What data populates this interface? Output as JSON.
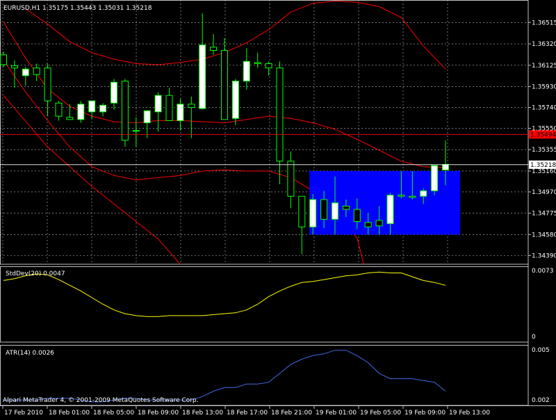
{
  "header": {
    "symbol_text": "EURUSD,H1  1.35175 1.35443 1.35031 1.35218"
  },
  "chart_data": [
    {
      "type": "candlestick",
      "symbol": "EURUSD",
      "timeframe": "H1",
      "ohlc_header": {
        "open": 1.35175,
        "high": 1.35443,
        "low": 1.35031,
        "close": 1.35218
      },
      "y_ticks": [
        1.36515,
        1.3632,
        1.36125,
        1.3593,
        1.3574,
        1.3555,
        1.35355,
        1.3516,
        1.3497,
        1.34775,
        1.3458,
        1.3439
      ],
      "ylim": [
        1.3431,
        1.3672
      ],
      "price_markers": [
        {
          "value": "1.35494",
          "color": "#ff0000",
          "text_color": "#000000"
        },
        {
          "value": "1.35218",
          "color": "#ffffff",
          "text_color": "#000000"
        }
      ],
      "x_tick_labels": [
        "17 Feb 2010",
        "18 Feb 01:00",
        "18 Feb 05:00",
        "18 Feb 09:00",
        "18 Feb 13:00",
        "18 Feb 17:00",
        "18 Feb 21:00",
        "19 Feb 01:00",
        "19 Feb 05:00",
        "19 Feb 09:00",
        "19 Feb 13:00"
      ],
      "candles": [
        {
          "o": 1.3622,
          "h": 1.3625,
          "l": 1.3611,
          "c": 1.3613
        },
        {
          "o": 1.3612,
          "h": 1.3617,
          "l": 1.3592,
          "c": 1.361
        },
        {
          "o": 1.3603,
          "h": 1.3611,
          "l": 1.3594,
          "c": 1.3609
        },
        {
          "o": 1.361,
          "h": 1.3614,
          "l": 1.3598,
          "c": 1.3604
        },
        {
          "o": 1.361,
          "h": 1.3614,
          "l": 1.3566,
          "c": 1.358
        },
        {
          "o": 1.3578,
          "h": 1.358,
          "l": 1.3562,
          "c": 1.3566
        },
        {
          "o": 1.3565,
          "h": 1.3577,
          "l": 1.3563,
          "c": 1.3563
        },
        {
          "o": 1.3563,
          "h": 1.358,
          "l": 1.356,
          "c": 1.3577
        },
        {
          "o": 1.357,
          "h": 1.358,
          "l": 1.3564,
          "c": 1.358
        },
        {
          "o": 1.357,
          "h": 1.3578,
          "l": 1.3566,
          "c": 1.3576
        },
        {
          "o": 1.3578,
          "h": 1.36,
          "l": 1.3572,
          "c": 1.3597
        },
        {
          "o": 1.3598,
          "h": 1.36,
          "l": 1.3538,
          "c": 1.3544
        },
        {
          "o": 1.3553,
          "h": 1.3565,
          "l": 1.3538,
          "c": 1.3553
        },
        {
          "o": 1.356,
          "h": 1.357,
          "l": 1.3546,
          "c": 1.3571
        },
        {
          "o": 1.357,
          "h": 1.3588,
          "l": 1.3552,
          "c": 1.3585
        },
        {
          "o": 1.3585,
          "h": 1.3592,
          "l": 1.3562,
          "c": 1.3562
        },
        {
          "o": 1.3562,
          "h": 1.3582,
          "l": 1.3553,
          "c": 1.3577
        },
        {
          "o": 1.3577,
          "h": 1.3584,
          "l": 1.3546,
          "c": 1.3574
        },
        {
          "o": 1.3573,
          "h": 1.366,
          "l": 1.3572,
          "c": 1.3631
        },
        {
          "o": 1.3629,
          "h": 1.3641,
          "l": 1.3622,
          "c": 1.3626
        },
        {
          "o": 1.3626,
          "h": 1.3637,
          "l": 1.3563,
          "c": 1.3563
        },
        {
          "o": 1.3564,
          "h": 1.36,
          "l": 1.3558,
          "c": 1.3598
        },
        {
          "o": 1.3598,
          "h": 1.3628,
          "l": 1.359,
          "c": 1.3616
        },
        {
          "o": 1.3615,
          "h": 1.3624,
          "l": 1.361,
          "c": 1.3614
        },
        {
          "o": 1.3614,
          "h": 1.3616,
          "l": 1.3603,
          "c": 1.361
        },
        {
          "o": 1.361,
          "h": 1.3616,
          "l": 1.3504,
          "c": 1.3525
        },
        {
          "o": 1.3525,
          "h": 1.3534,
          "l": 1.3482,
          "c": 1.3493
        },
        {
          "o": 1.3493,
          "h": 1.3493,
          "l": 1.344,
          "c": 1.3465
        },
        {
          "o": 1.3465,
          "h": 1.3495,
          "l": 1.3458,
          "c": 1.349
        },
        {
          "o": 1.349,
          "h": 1.3498,
          "l": 1.3464,
          "c": 1.3472
        },
        {
          "o": 1.3472,
          "h": 1.3511,
          "l": 1.3458,
          "c": 1.3487
        },
        {
          "o": 1.3484,
          "h": 1.349,
          "l": 1.3474,
          "c": 1.3481
        },
        {
          "o": 1.3481,
          "h": 1.3491,
          "l": 1.3463,
          "c": 1.347
        },
        {
          "o": 1.3469,
          "h": 1.3478,
          "l": 1.3458,
          "c": 1.3465
        },
        {
          "o": 1.3471,
          "h": 1.3484,
          "l": 1.3458,
          "c": 1.3466
        },
        {
          "o": 1.3468,
          "h": 1.3496,
          "l": 1.3458,
          "c": 1.3494
        },
        {
          "o": 1.3494,
          "h": 1.3516,
          "l": 1.3491,
          "c": 1.3493
        },
        {
          "o": 1.3493,
          "h": 1.3516,
          "l": 1.349,
          "c": 1.3492
        },
        {
          "o": 1.3493,
          "h": 1.35,
          "l": 1.3486,
          "c": 1.3498
        },
        {
          "o": 1.3498,
          "h": 1.3517,
          "l": 1.3494,
          "c": 1.3521
        },
        {
          "o": 1.3517,
          "h": 1.3544,
          "l": 1.3503,
          "c": 1.3522
        }
      ],
      "band_lines": [
        {
          "color": "#ff0000",
          "points": [
            [
              0,
              1.3652
            ],
            [
              2,
              1.3619
            ],
            [
              4,
              1.3591
            ],
            [
              6,
              1.3575
            ],
            [
              8,
              1.3566
            ],
            [
              10,
              1.3561
            ],
            [
              12,
              1.356
            ],
            [
              14,
              1.3562
            ],
            [
              16,
              1.3562
            ],
            [
              18,
              1.3561
            ],
            [
              20,
              1.356
            ],
            [
              22,
              1.3563
            ],
            [
              24,
              1.3566
            ],
            [
              26,
              1.3564
            ],
            [
              27,
              1.3562
            ],
            [
              28,
              1.356
            ],
            [
              30,
              1.3554
            ],
            [
              32,
              1.3545
            ],
            [
              34,
              1.3535
            ],
            [
              36,
              1.3525
            ],
            [
              38,
              1.352
            ],
            [
              40,
              1.3519
            ]
          ]
        },
        {
          "color": "#ff0000",
          "points": [
            [
              2,
              1.3664
            ],
            [
              4,
              1.365
            ],
            [
              6,
              1.3634
            ],
            [
              8,
              1.3624
            ],
            [
              10,
              1.3618
            ],
            [
              12,
              1.3614
            ],
            [
              14,
              1.3613
            ],
            [
              16,
              1.3615
            ],
            [
              18,
              1.3618
            ],
            [
              20,
              1.3624
            ],
            [
              22,
              1.3633
            ],
            [
              24,
              1.3645
            ],
            [
              26,
              1.3661
            ],
            [
              28,
              1.3669
            ],
            [
              30,
              1.3671
            ],
            [
              32,
              1.367
            ],
            [
              34,
              1.3666
            ],
            [
              36,
              1.3656
            ],
            [
              38,
              1.363
            ],
            [
              40,
              1.3609
            ]
          ]
        },
        {
          "color": "#ff0000",
          "points": [
            [
              0,
              1.3617
            ],
            [
              2,
              1.3588
            ],
            [
              4,
              1.3562
            ],
            [
              6,
              1.3538
            ],
            [
              8,
              1.352
            ],
            [
              10,
              1.3512
            ],
            [
              12,
              1.3508
            ],
            [
              14,
              1.351
            ],
            [
              16,
              1.3512
            ],
            [
              18,
              1.3516
            ],
            [
              20,
              1.3517
            ],
            [
              22,
              1.3516
            ],
            [
              24,
              1.3516
            ],
            [
              26,
              1.351
            ],
            [
              28,
              1.3498
            ],
            [
              30,
              1.3478
            ],
            [
              31,
              1.3466
            ],
            [
              32,
              1.3455
            ],
            [
              32.6,
              1.3431
            ]
          ]
        },
        {
          "color": "#ff0000",
          "points": [
            [
              0,
              1.3585
            ],
            [
              4,
              1.3538
            ],
            [
              8,
              1.3502
            ],
            [
              12,
              1.347
            ],
            [
              14,
              1.3454
            ],
            [
              16,
              1.3431
            ]
          ]
        }
      ],
      "highlight_box": {
        "from_index": 28,
        "to_index": 41,
        "y_top": 1.3516,
        "y_bottom": 1.3458,
        "color": "#0000ff"
      }
    },
    {
      "type": "line",
      "indicator": "StdDev",
      "label": "StdDev(20) 0.0047",
      "y_ticks_labels": [
        "0.0073",
        "0"
      ],
      "ylim": [
        0,
        0.008
      ],
      "series": [
        {
          "color": "#ffff00",
          "values": [
            0.0065,
            0.0067,
            0.007,
            0.0072,
            0.0071,
            0.0066,
            0.006,
            0.0054,
            0.0047,
            0.004,
            0.0034,
            0.003,
            0.0028,
            0.0027,
            0.0027,
            0.0028,
            0.0028,
            0.0028,
            0.0028,
            0.0029,
            0.003,
            0.0031,
            0.0034,
            0.004,
            0.0048,
            0.0054,
            0.0059,
            0.0063,
            0.0064,
            0.0066,
            0.0068,
            0.007,
            0.0071,
            0.0073,
            0.0074,
            0.0073,
            0.0073,
            0.0069,
            0.0065,
            0.0063,
            0.006
          ]
        }
      ]
    },
    {
      "type": "line",
      "indicator": "ATR",
      "label": "ATR(14) 0.0026",
      "y_ticks_labels": [
        "0.005",
        "0.002"
      ],
      "ylim": [
        0.0018,
        0.0052
      ],
      "series": [
        {
          "color": "#4169e1",
          "values": [
            0.0021,
            0.0021,
            0.0021,
            0.0021,
            0.0022,
            0.0022,
            0.0022,
            0.0021,
            0.002,
            0.002,
            0.0021,
            0.0022,
            0.0022,
            0.0021,
            0.0021,
            0.0021,
            0.0021,
            0.0021,
            0.0023,
            0.0026,
            0.0028,
            0.0028,
            0.003,
            0.003,
            0.0031,
            0.0036,
            0.0041,
            0.0044,
            0.0046,
            0.0047,
            0.0049,
            0.0049,
            0.0046,
            0.0042,
            0.0036,
            0.0033,
            0.0033,
            0.0033,
            0.0032,
            0.0031,
            0.0026
          ]
        }
      ]
    }
  ],
  "footer": {
    "copyright": "Alpari MetaTrader 4, © 2001-2009 MetaQuotes Software Corp."
  },
  "colors": {
    "background": "#000000",
    "grid": "#c0c0c0",
    "up_candle": "#ffffff",
    "down_candle": "#000000",
    "candle_outline": "#00ff00"
  }
}
